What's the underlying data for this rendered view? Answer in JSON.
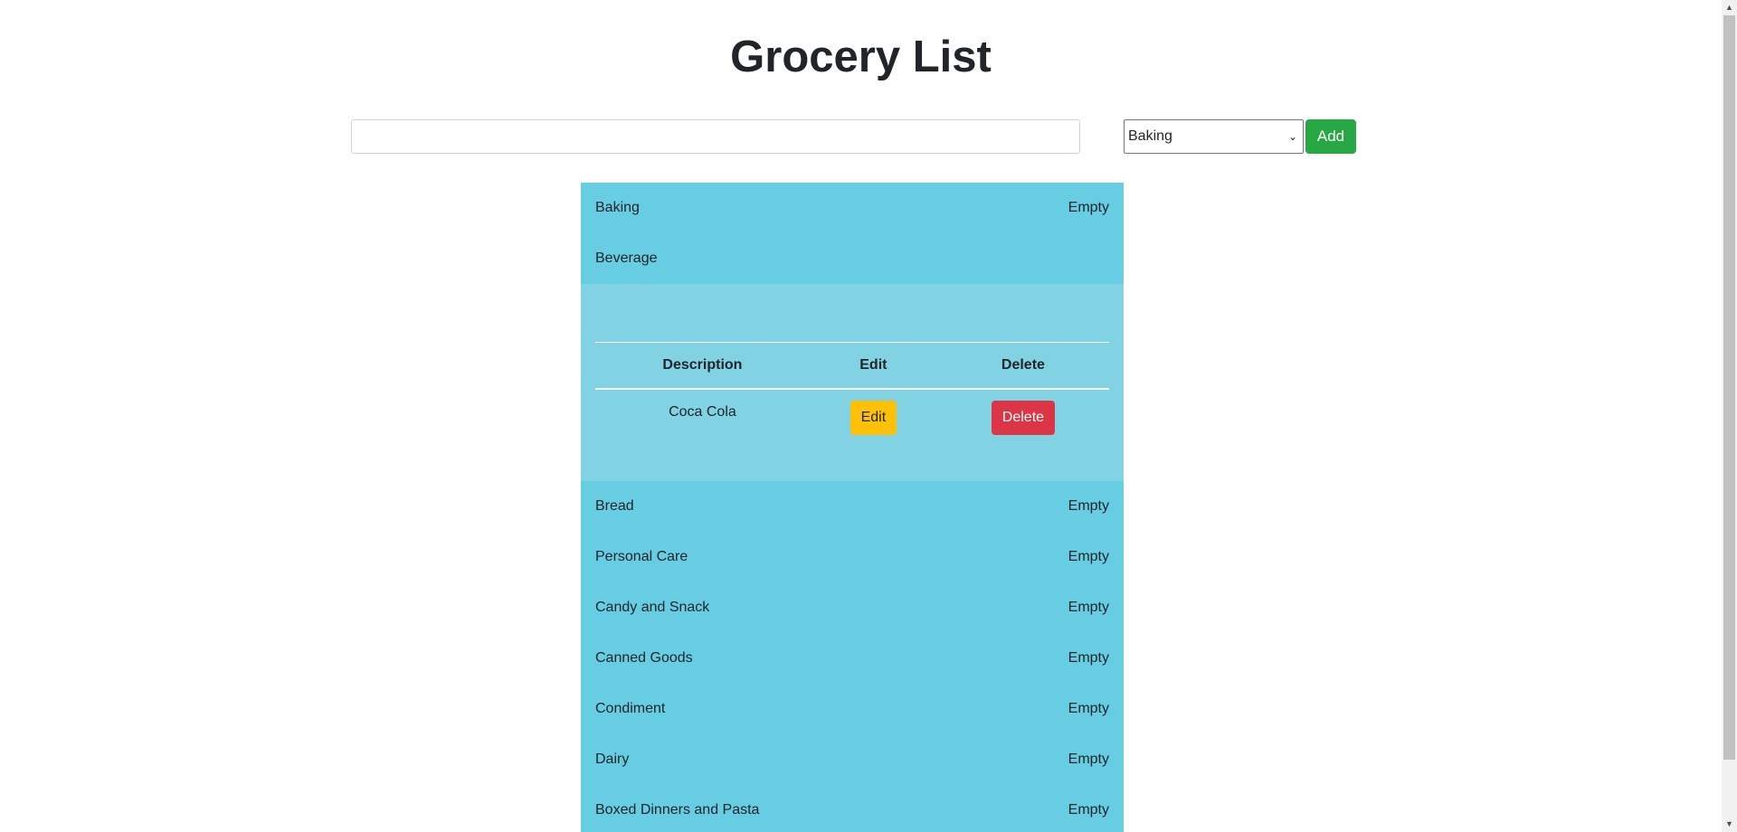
{
  "page": {
    "title": "Grocery List"
  },
  "form": {
    "input_value": "",
    "input_placeholder": "",
    "selected_category": "Baking",
    "add_label": "Add"
  },
  "categories": [
    {
      "name": "Baking",
      "status": "Empty"
    },
    {
      "name": "Beverage",
      "status": ""
    },
    {
      "name": "Bread",
      "status": "Empty"
    },
    {
      "name": "Personal Care",
      "status": "Empty"
    },
    {
      "name": "Candy and Snack",
      "status": "Empty"
    },
    {
      "name": "Canned Goods",
      "status": "Empty"
    },
    {
      "name": "Condiment",
      "status": "Empty"
    },
    {
      "name": "Dairy",
      "status": "Empty"
    },
    {
      "name": "Boxed Dinners and Pasta",
      "status": "Empty"
    }
  ],
  "expanded": {
    "category": "Beverage",
    "columns": [
      "Description",
      "Edit",
      "Delete"
    ],
    "items": [
      {
        "description": "Coca Cola",
        "edit_label": "Edit",
        "delete_label": "Delete"
      }
    ]
  },
  "colors": {
    "list_bg": "#66cde3",
    "expanded_bg": "#81d3e4",
    "add_button": "#28a745",
    "edit_button": "#ffc107",
    "delete_button": "#dc3545"
  }
}
